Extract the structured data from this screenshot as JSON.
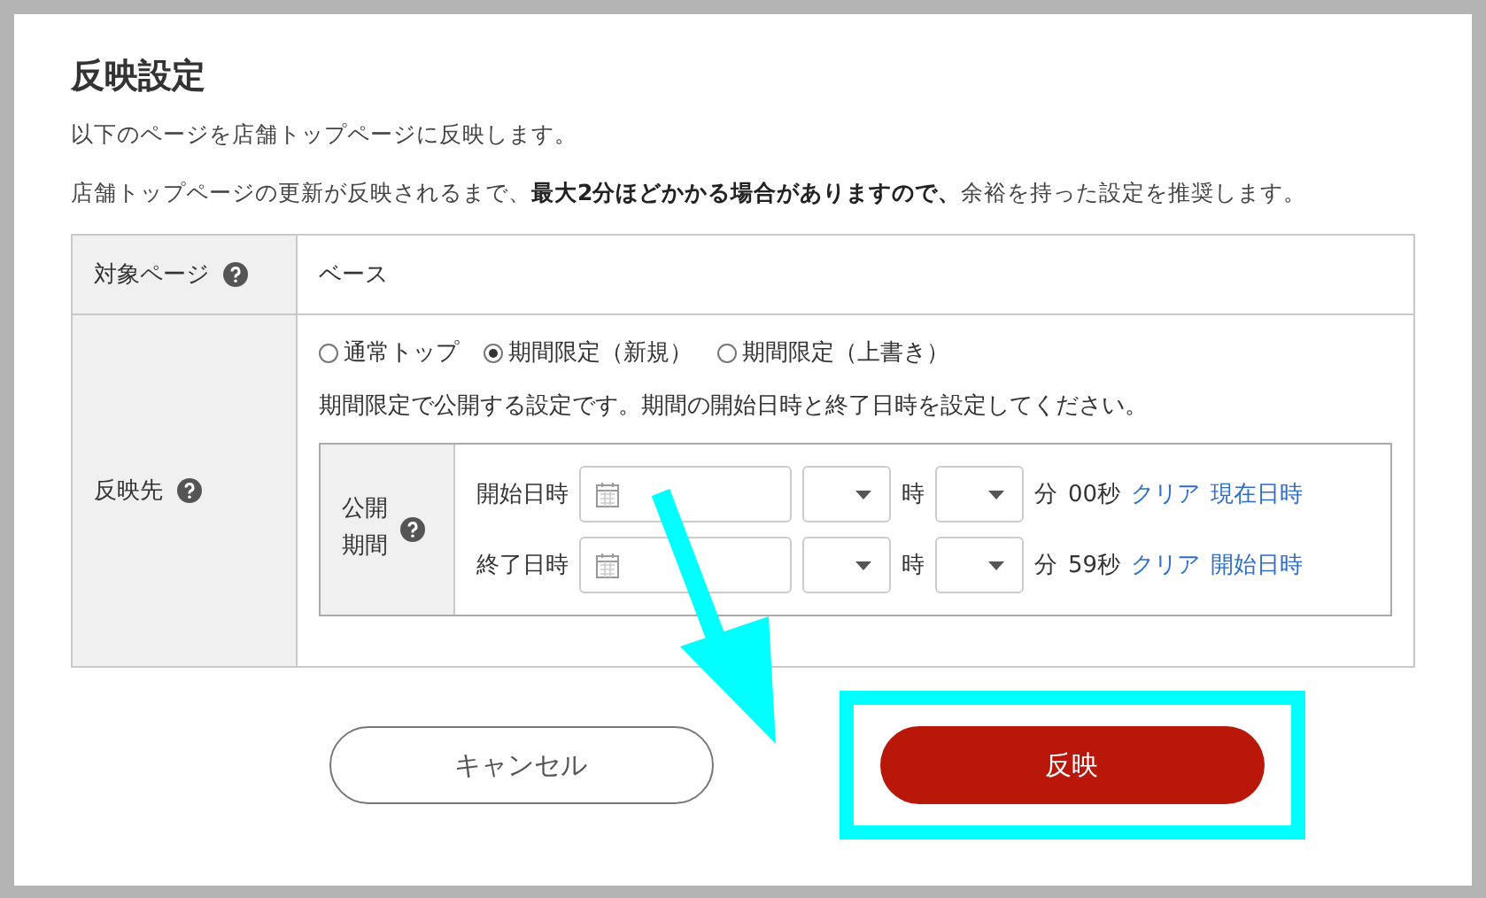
{
  "title": "反映設定",
  "intro": "以下のページを店舗トップページに反映します。",
  "notice": "店舗トップページの更新が反映されるまで、**最大2分ほどかかる場合がありますので、**余裕を持った設定を推奨します。",
  "target": {
    "label": "対象ページ",
    "value": "ベース"
  },
  "destination": {
    "label": "反映先",
    "options": [
      {
        "label": "通常トップ",
        "selected": false
      },
      {
        "label": "期間限定（新規）",
        "selected": true
      },
      {
        "label": "期間限定（上書き）",
        "selected": false
      }
    ],
    "description": "期間限定で公開する設定です。期間の開始日時と終了日時を設定してください。",
    "period": {
      "label": "公開期間",
      "rows": [
        {
          "label": "開始日時",
          "hour_unit": "時",
          "minute_unit": "分",
          "seconds": "00秒",
          "links": [
            "クリア",
            "現在日時"
          ]
        },
        {
          "label": "終了日時",
          "hour_unit": "時",
          "minute_unit": "分",
          "seconds": "59秒",
          "links": [
            "クリア",
            "開始日時"
          ]
        }
      ]
    }
  },
  "buttons": [
    {
      "label": "キャンセル",
      "kind": "secondary",
      "highlighted": false
    },
    {
      "label": "反映",
      "kind": "primary",
      "highlighted": true
    }
  ]
}
